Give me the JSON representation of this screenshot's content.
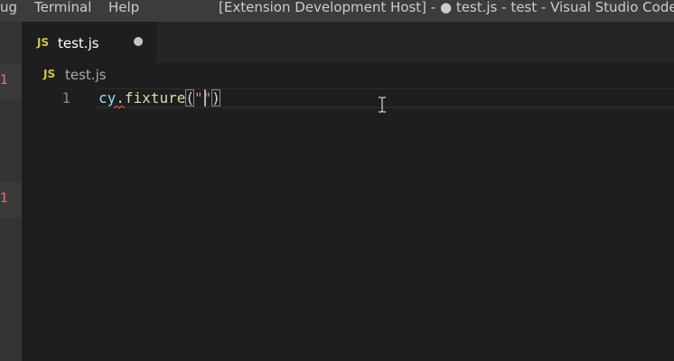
{
  "menu": {
    "items": [
      "ug",
      "Terminal",
      "Help"
    ]
  },
  "window": {
    "title": "[Extension Development Host] - ● test.js - test - Visual Studio Code"
  },
  "activity_bar": {
    "badges": [
      "1",
      "1"
    ]
  },
  "tabs": [
    {
      "icon": "JS",
      "label": "test.js",
      "dirty": true
    }
  ],
  "breadcrumb": {
    "icon": "JS",
    "label": "test.js"
  },
  "editor": {
    "lines": [
      {
        "number": "1",
        "tokens": {
          "obj": "cy",
          "dot": ".",
          "fn": "fixture",
          "open": "(",
          "quote_open": "\"",
          "quote_close": "\"",
          "close": ")"
        }
      }
    ]
  },
  "colors": {
    "titlebar": "#3c3c3c",
    "activitybar": "#333333",
    "editor_bg": "#1e1e1e",
    "tabsbar": "#252526",
    "js_icon": "#cbcb41",
    "badge": "#e07a7a"
  },
  "icons": {
    "file_type": "js-file-icon",
    "dirty": "unsaved-dot-icon",
    "cursor": "text-ibeam-cursor-icon",
    "squiggle": "error-squiggle-icon"
  }
}
